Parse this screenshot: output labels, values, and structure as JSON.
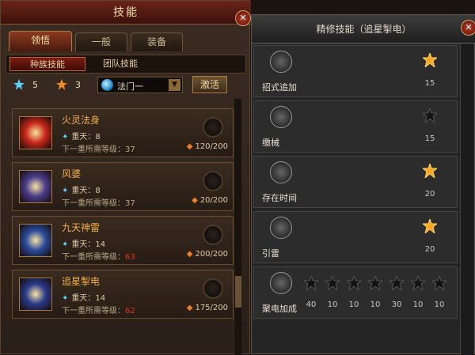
{
  "window_title": "技能",
  "tabs": [
    "领悟",
    "一般",
    "装备"
  ],
  "subtabs": [
    "种族技能",
    "团队技能"
  ],
  "resources": {
    "blue_count": "5",
    "orange_count": "3"
  },
  "school_select": {
    "value": "法门一"
  },
  "activate_label": "激活",
  "skills": [
    {
      "name": "火灵法身",
      "level": "重天：8",
      "req": "下一重所需等级：37",
      "req_red": "",
      "cost": "120/200",
      "icon_color": "#c8281a"
    },
    {
      "name": "风婆",
      "level": "重天：8",
      "req": "下一重所需等级：37",
      "req_red": "",
      "cost": "20/200",
      "icon_color": "#4a3c8a"
    },
    {
      "name": "九天神雷",
      "level": "重天：14",
      "req": "下一重所需等级：",
      "req_red": "63",
      "cost": "200/200",
      "icon_color": "#2a4a9a"
    },
    {
      "name": "追星掣电",
      "level": "重天：14",
      "req": "下一重所需等级：",
      "req_red": "62",
      "cost": "175/200",
      "icon_color": "#2a3a8a"
    }
  ],
  "refine_panel": {
    "title": "精修技能（追星掣电）",
    "rows": [
      {
        "label": "招式追加",
        "nodes": [
          {
            "value": "15",
            "lit": true
          }
        ]
      },
      {
        "label": "缴械",
        "nodes": [
          {
            "value": "15",
            "lit": false
          }
        ]
      },
      {
        "label": "存在时间",
        "nodes": [
          {
            "value": "20",
            "lit": true
          }
        ]
      },
      {
        "label": "引雷",
        "nodes": [
          {
            "value": "20",
            "lit": true
          }
        ]
      },
      {
        "label": "聚电加成",
        "nodes": [
          {
            "value": "40",
            "lit": false
          },
          {
            "value": "10",
            "lit": false
          },
          {
            "value": "10",
            "lit": false
          },
          {
            "value": "10",
            "lit": false
          },
          {
            "value": "30",
            "lit": false
          },
          {
            "value": "10",
            "lit": false
          },
          {
            "value": "10",
            "lit": false
          }
        ]
      }
    ]
  },
  "colors": {
    "accent_gold": "#f0b048",
    "lit_node": "#f5a623",
    "dark_node": "#111111",
    "red_text": "#e8341e"
  }
}
